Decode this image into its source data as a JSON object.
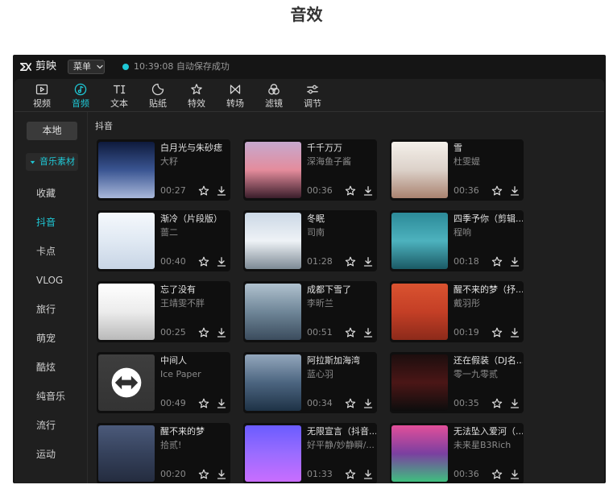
{
  "page": {
    "heading": "音效"
  },
  "app": {
    "logo_icon": "capcut-logo-icon",
    "logo_text": "剪映",
    "menu_label": "菜单",
    "save_status": "10:39:08 自动保存成功",
    "colors": {
      "accent": "#1fc8d6",
      "status_dot": "#1fc8d6"
    }
  },
  "toolbar": {
    "items": [
      {
        "label": "视频",
        "icon": "video-icon",
        "active": false
      },
      {
        "label": "音频",
        "icon": "audio-icon",
        "active": true
      },
      {
        "label": "文本",
        "icon": "text-icon",
        "active": false
      },
      {
        "label": "贴纸",
        "icon": "sticker-icon",
        "active": false
      },
      {
        "label": "特效",
        "icon": "effects-icon",
        "active": false
      },
      {
        "label": "转场",
        "icon": "transition-icon",
        "active": false
      },
      {
        "label": "滤镜",
        "icon": "filter-icon",
        "active": false
      },
      {
        "label": "调节",
        "icon": "adjust-icon",
        "active": false
      }
    ]
  },
  "sidebar": {
    "local_label": "本地",
    "group": {
      "label": "音乐素材",
      "icon": "caret-down-icon",
      "expanded": true
    },
    "items": [
      {
        "label": "收藏",
        "active": false
      },
      {
        "label": "抖音",
        "active": true
      },
      {
        "label": "卡点",
        "active": false
      },
      {
        "label": "VLOG",
        "active": false
      },
      {
        "label": "旅行",
        "active": false
      },
      {
        "label": "萌宠",
        "active": false
      },
      {
        "label": "酷炫",
        "active": false
      },
      {
        "label": "纯音乐",
        "active": false
      },
      {
        "label": "流行",
        "active": false
      },
      {
        "label": "运动",
        "active": false
      }
    ]
  },
  "content": {
    "section_label": "抖音",
    "card_actions": {
      "favorite_icon": "star-outline-icon",
      "download_icon": "download-icon"
    },
    "tracks": [
      {
        "title": "白月光与朱砂痣",
        "artist": "大籽",
        "duration": "00:27",
        "cover": [
          "#0e1a3c",
          "#3a5592",
          "#a9b8da"
        ]
      },
      {
        "title": "千千万万",
        "artist": "深海鱼子酱",
        "duration": "00:36",
        "cover": [
          "#c6a9cf",
          "#e48c9c",
          "#3b1e2b"
        ]
      },
      {
        "title": "雪",
        "artist": "杜雯媞",
        "duration": "00:36",
        "cover": [
          "#f4f0ea",
          "#dcd1c9",
          "#a9826f"
        ]
      },
      {
        "title": "渐冷（片段版）",
        "artist": "蔷二",
        "duration": "00:40",
        "cover": [
          "#f5f8fc",
          "#e0e9f3",
          "#c8d5e5"
        ]
      },
      {
        "title": "冬眠",
        "artist": "司南",
        "duration": "01:28",
        "cover": [
          "#cbd8e6",
          "#eef2f6",
          "#7d8a95"
        ]
      },
      {
        "title": "四季予你（剪辑...",
        "artist": "程响",
        "duration": "00:18",
        "cover": [
          "#2c8a98",
          "#4db2be",
          "#1b5a65"
        ]
      },
      {
        "title": "忘了没有",
        "artist": "王靖雯不胖",
        "duration": "00:25",
        "cover": [
          "#ffffff",
          "#ececec",
          "#b9b9b9"
        ]
      },
      {
        "title": "成都下雪了",
        "artist": "李昕兰",
        "duration": "00:51",
        "cover": [
          "#b1c2cf",
          "#6f8698",
          "#3b4c5d"
        ]
      },
      {
        "title": "醒不来的梦（抒...",
        "artist": "戴羽彤",
        "duration": "00:19",
        "cover": [
          "#da5330",
          "#c43f26",
          "#8c2a1a"
        ]
      },
      {
        "title": "中间人",
        "artist": "Ice Paper",
        "duration": "00:49",
        "cover": [
          "#3e3e3e",
          "#333333"
        ],
        "cover_icon": "double-arrow-icon"
      },
      {
        "title": "阿拉斯加海湾",
        "artist": "蓝心羽",
        "duration": "00:34",
        "cover": [
          "#93a7bc",
          "#4c6580",
          "#1e3246"
        ]
      },
      {
        "title": "还在假装（DJ名...",
        "artist": "零一九零贰",
        "duration": "00:35",
        "cover": [
          "#1c0e0e",
          "#4b1616",
          "#0d0d0d"
        ]
      },
      {
        "title": "醒不来的梦",
        "artist": "拾贰!",
        "duration": "00:20",
        "cover": [
          "#4b5a7a",
          "#35415b",
          "#242c3f"
        ]
      },
      {
        "title": "无限宣言（抖音...",
        "artist": "好平静/妙静瞬/...",
        "duration": "01:33",
        "cover": [
          "#6a5cff",
          "#9a6cff",
          "#c96dff"
        ]
      },
      {
        "title": "无法坠入爱河（...",
        "artist": "未来星B3Rich",
        "duration": "00:36",
        "cover": [
          "#e24f9a",
          "#7b3fa0",
          "#3fbf7f"
        ]
      }
    ]
  }
}
